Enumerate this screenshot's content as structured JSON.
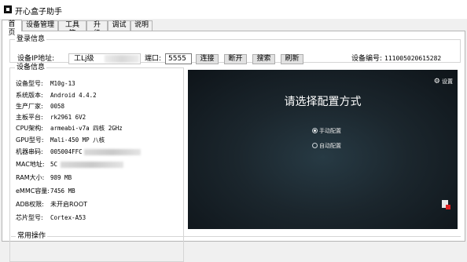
{
  "window": {
    "title": "开心盒子助手"
  },
  "tabs": [
    {
      "label": "首页",
      "active": true
    },
    {
      "label": "设备管理",
      "active": false
    },
    {
      "label": "工具箱",
      "active": false
    },
    {
      "label": "升级",
      "active": false
    },
    {
      "label": "调试",
      "active": false
    },
    {
      "label": "说明",
      "active": false
    }
  ],
  "login": {
    "group_title": "登录信息",
    "ip_label": "设备IP地址:",
    "ip_value": "工Lj级",
    "port_label": "端口:",
    "port_value": "5555",
    "buttons": {
      "connect": "连接",
      "disconnect": "断开",
      "search": "搜索",
      "refresh": "刷新"
    },
    "device_no_label": "设备编号:",
    "device_no_value": "111005020615282"
  },
  "device_info": {
    "group_title": "设备信息",
    "rows": [
      {
        "key": "设备型号:",
        "value": "M10g-13"
      },
      {
        "key": "系统版本:",
        "value": "Android 4.4.2"
      },
      {
        "key": "生产厂家:",
        "value": "0058"
      },
      {
        "key": "主板平台:",
        "value": "rk2961 6V2"
      },
      {
        "key": "CPU架构:",
        "value": "armeabi-v7a 四核 2GHz"
      },
      {
        "key": "GPU型号:",
        "value": "Mali-450 MP 八核"
      },
      {
        "key": "机器串码:",
        "value": "005004FFC"
      },
      {
        "key": "MAC地址:",
        "value": "5C"
      },
      {
        "key": "RAM大小:",
        "value": "989 MB"
      },
      {
        "key": "eMMC容量:",
        "value": "7456 MB"
      },
      {
        "key": "ADB权限:",
        "value": "未开启ROOT"
      },
      {
        "key": "芯片型号:",
        "value": "Cortex-A53"
      }
    ]
  },
  "screen": {
    "settings_label": "设置",
    "title": "请选择配置方式",
    "options": [
      {
        "label": "手动配置",
        "selected": true
      },
      {
        "label": "自动配置",
        "selected": false
      }
    ]
  },
  "common": {
    "group_title": "常用操作"
  }
}
